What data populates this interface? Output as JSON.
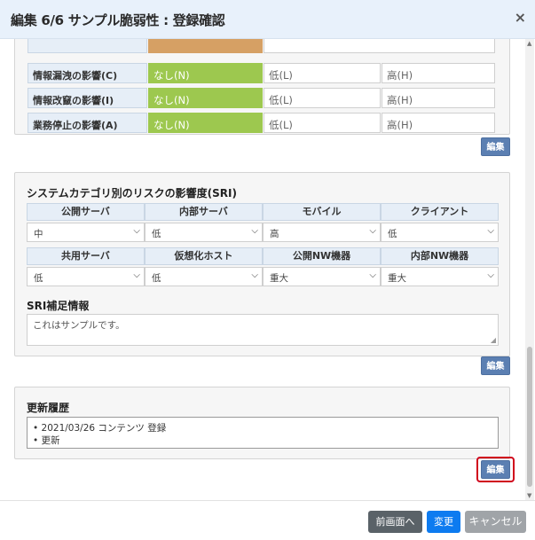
{
  "dialog": {
    "title": "編集 6/6 サンプル脆弱性 : 登録確認",
    "close_icon": "×"
  },
  "impact": {
    "rows": [
      {
        "label": "情報漏洩の影響(C)",
        "options": [
          "なし(N)",
          "低(L)",
          "高(H)"
        ],
        "selected": 0
      },
      {
        "label": "情報改竄の影響(I)",
        "options": [
          "なし(N)",
          "低(L)",
          "高(H)"
        ],
        "selected": 0
      },
      {
        "label": "業務停止の影響(A)",
        "options": [
          "なし(N)",
          "低(L)",
          "高(H)"
        ],
        "selected": 0
      }
    ],
    "edit_label": "編集"
  },
  "sri": {
    "title": "システムカテゴリ別のリスクの影響度(SRI)",
    "row1_headers": [
      "公開サーバ",
      "内部サーバ",
      "モバイル",
      "クライアント"
    ],
    "row1_values": [
      "中",
      "低",
      "高",
      "低"
    ],
    "row2_headers": [
      "共用サーバ",
      "仮想化ホスト",
      "公開NW機器",
      "内部NW機器"
    ],
    "row2_values": [
      "低",
      "低",
      "重大",
      "重大"
    ],
    "supplement_label": "SRI補足情報",
    "supplement_text": "これはサンプルです。",
    "edit_label": "編集"
  },
  "history": {
    "title": "更新履歴",
    "entries": [
      "2021/03/26 コンテンツ 登録",
      "更新"
    ],
    "edit_label": "編集"
  },
  "footer": {
    "back_label": "前画面へ",
    "change_label": "変更",
    "cancel_label": "キャンセル"
  },
  "colors": {
    "selected_option": "#9dc84f",
    "header_bg": "#e8f1fb",
    "edit_button": "#5b7fb2",
    "primary": "#0d7bf0",
    "highlight_ring": "#d0021b"
  }
}
